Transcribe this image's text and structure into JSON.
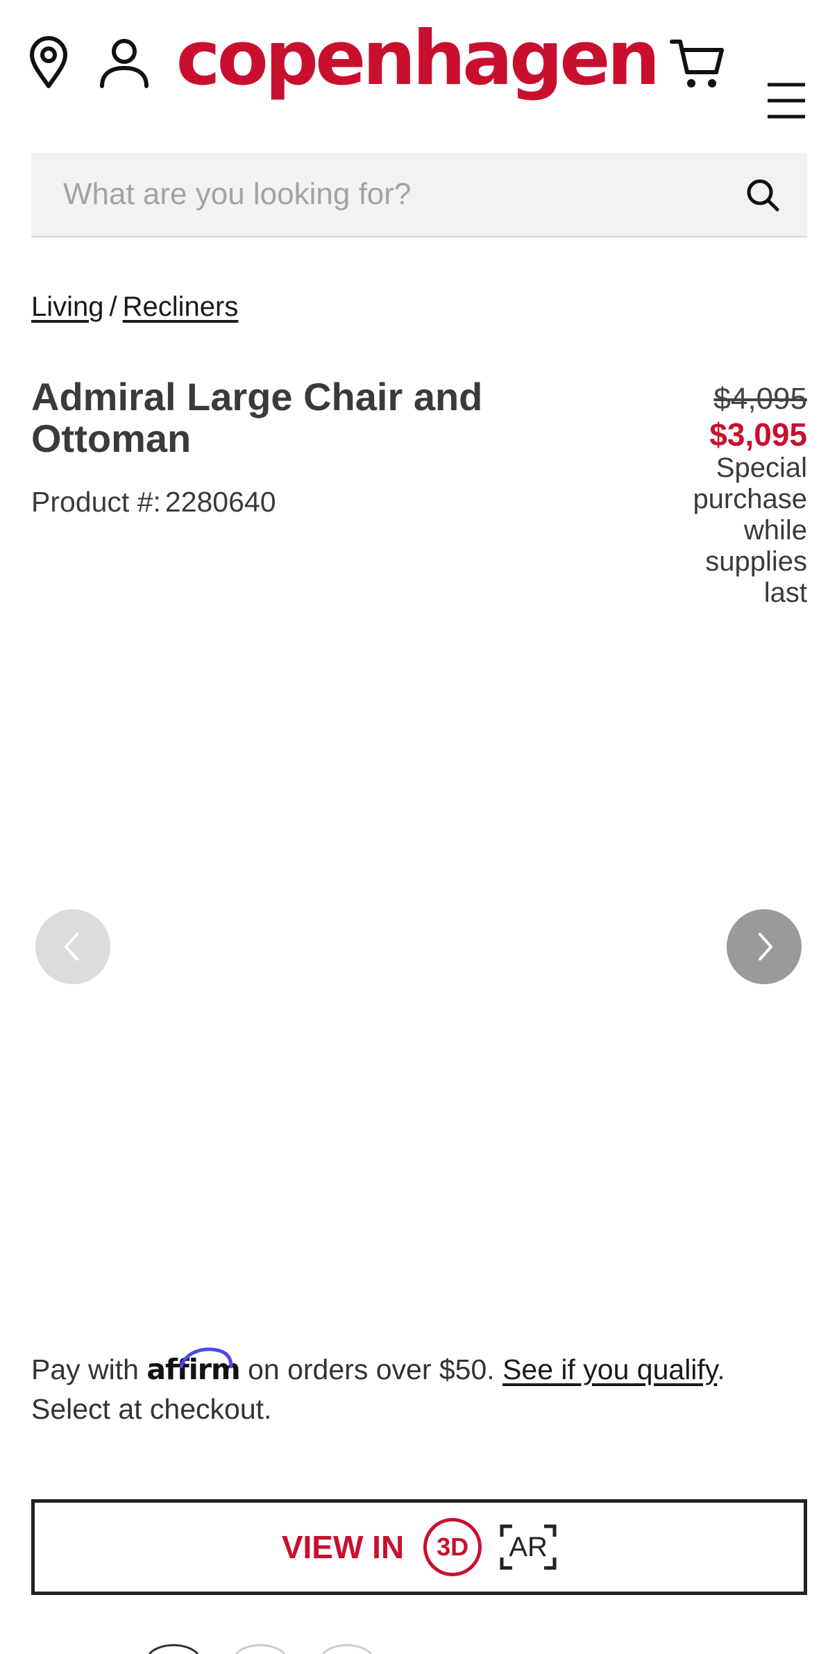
{
  "brand": {
    "logo_text": "copenhagen",
    "accent_color": "#c8102e"
  },
  "header": {
    "icons": [
      "location-pin-icon",
      "account-icon",
      "cart-icon",
      "menu-icon"
    ]
  },
  "search": {
    "placeholder": "What are you looking for?"
  },
  "breadcrumb": {
    "items": [
      "Living",
      "Recliners"
    ],
    "separator": "/"
  },
  "product": {
    "title": "Admiral Large Chair and Ottoman",
    "number_label": "Product #:",
    "number": "2280640",
    "original_price": "$4,095",
    "sale_price": "$3,095",
    "promo_text": "Special purchase while supplies last"
  },
  "carousel": {
    "prev_icon": "chevron-left-icon",
    "next_icon": "chevron-right-icon"
  },
  "financing": {
    "prefix": "Pay with",
    "provider": "affirm",
    "middle": "on orders over $50.",
    "link": "See if you qualify",
    "suffix": ".",
    "line2": "Select at checkout."
  },
  "view_button": {
    "label": "VIEW IN",
    "badge_3d": "3D",
    "badge_ar": "AR"
  }
}
